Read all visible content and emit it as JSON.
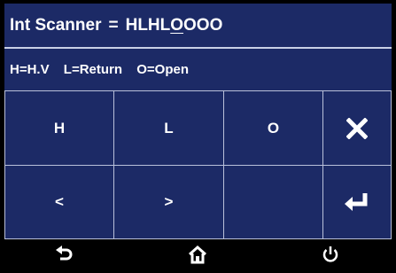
{
  "title": {
    "label": "Int Scanner",
    "equals": "=",
    "value_before_cursor": "HLHL",
    "value_cursor_char": "O",
    "value_after_cursor": "OOO"
  },
  "hints": {
    "h": "H=H.V",
    "l": "L=Return",
    "o": "O=Open"
  },
  "keypad": {
    "h_label": "H",
    "l_label": "L",
    "o_label": "O",
    "clear_icon": "close-icon",
    "left_label": "<",
    "right_label": ">",
    "enter_icon": "enter-icon"
  },
  "nav": {
    "back_icon": "back-icon",
    "home_icon": "home-icon",
    "power_icon": "power-icon"
  },
  "colors": {
    "panel": "#1c2a66",
    "grid_line": "#b9c0da",
    "text": "#ffffff",
    "background": "#000000"
  }
}
